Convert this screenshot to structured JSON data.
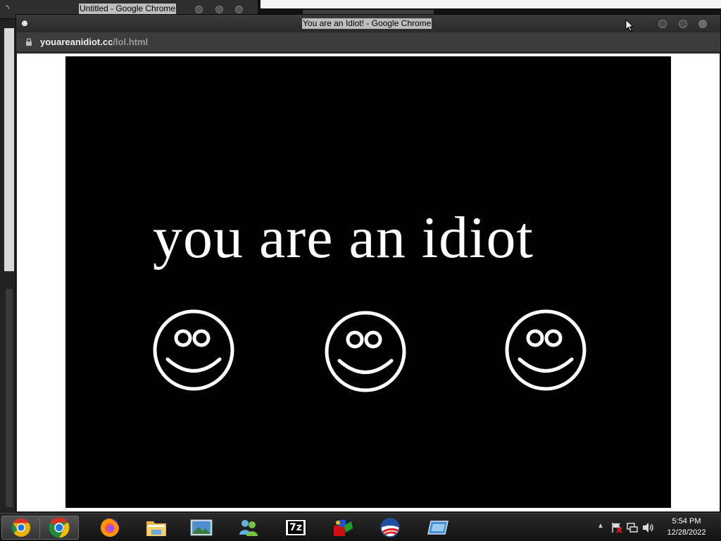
{
  "back_window": {
    "title": "Untitled - Google Chrome"
  },
  "main_window": {
    "title": "You are an Idiot! - Google Chrome",
    "url_host": "youareanidiot.cc",
    "url_path": "/lol.html"
  },
  "page": {
    "headline": "you are an idiot",
    "smiley_count": 3,
    "colors": {
      "background": "#000000",
      "foreground": "#ffffff"
    }
  },
  "taskbar": {
    "apps": [
      {
        "name": "chrome-canary-icon"
      },
      {
        "name": "chrome-icon"
      },
      {
        "name": "firefox-icon"
      },
      {
        "name": "file-explorer-icon"
      },
      {
        "name": "photo-viewer-icon"
      },
      {
        "name": "messenger-icon"
      },
      {
        "name": "7zip-icon"
      },
      {
        "name": "paint-app-icon"
      },
      {
        "name": "obama-logo-icon"
      },
      {
        "name": "virtual-machine-icon"
      }
    ],
    "clock_time": "5:54 PM",
    "clock_date": "12/28/2022",
    "sevenzip_label": "7z"
  }
}
